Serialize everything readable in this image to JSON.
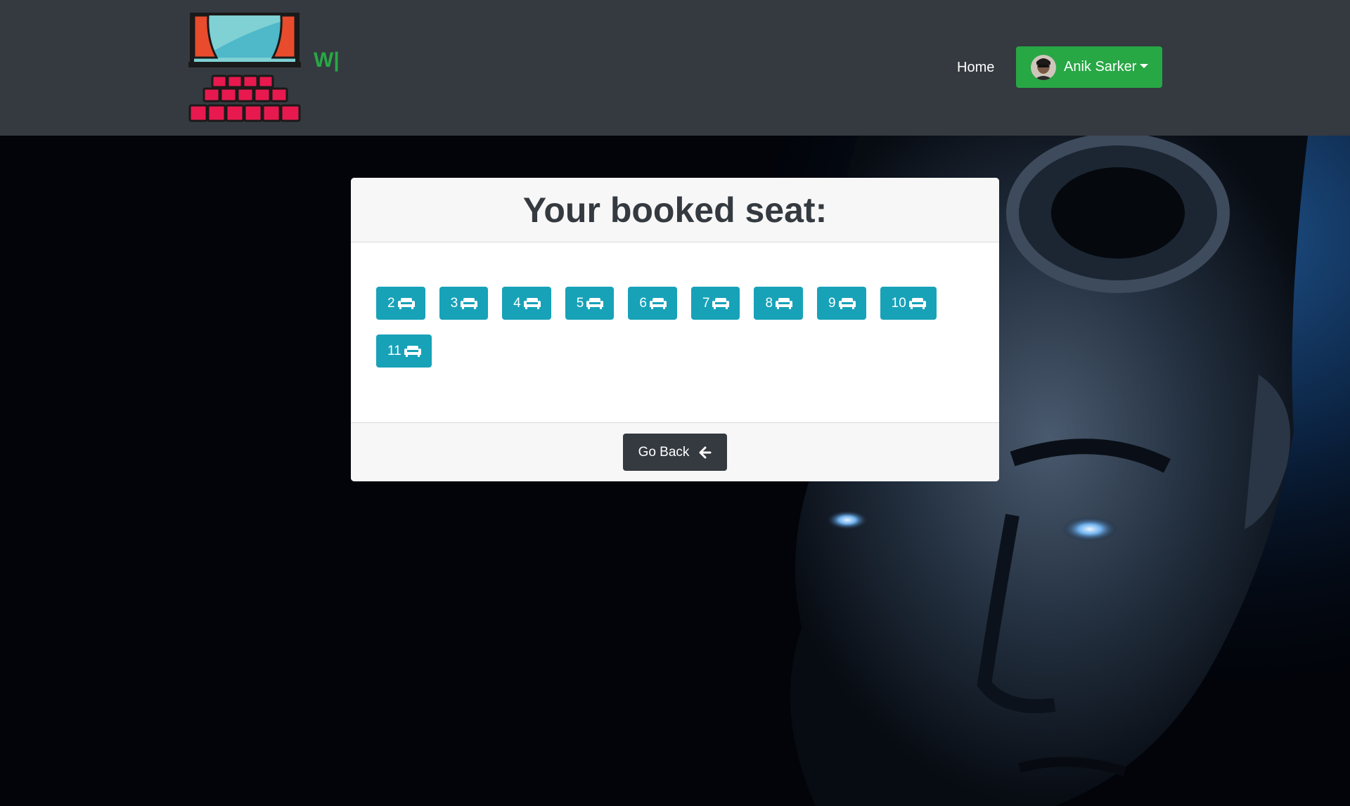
{
  "navbar": {
    "brand_text": "W|",
    "home_label": "Home",
    "user_name": "Anik Sarker",
    "icons": {
      "logo": "cinema-screen-seats-logo",
      "avatar": "user-avatar",
      "dropdown": "caret-down-icon"
    }
  },
  "card": {
    "title": "Your booked seat:",
    "seats": [
      "2",
      "3",
      "4",
      "5",
      "6",
      "7",
      "8",
      "9",
      "10",
      "11"
    ],
    "seat_icon": "couch-icon",
    "back_label": "Go Back",
    "back_icon": "arrow-left-icon"
  },
  "colors": {
    "navbar_bg": "#343a40",
    "brand_green": "#28a745",
    "seat_teal": "#17a2b8",
    "dark_button": "#343a40"
  }
}
